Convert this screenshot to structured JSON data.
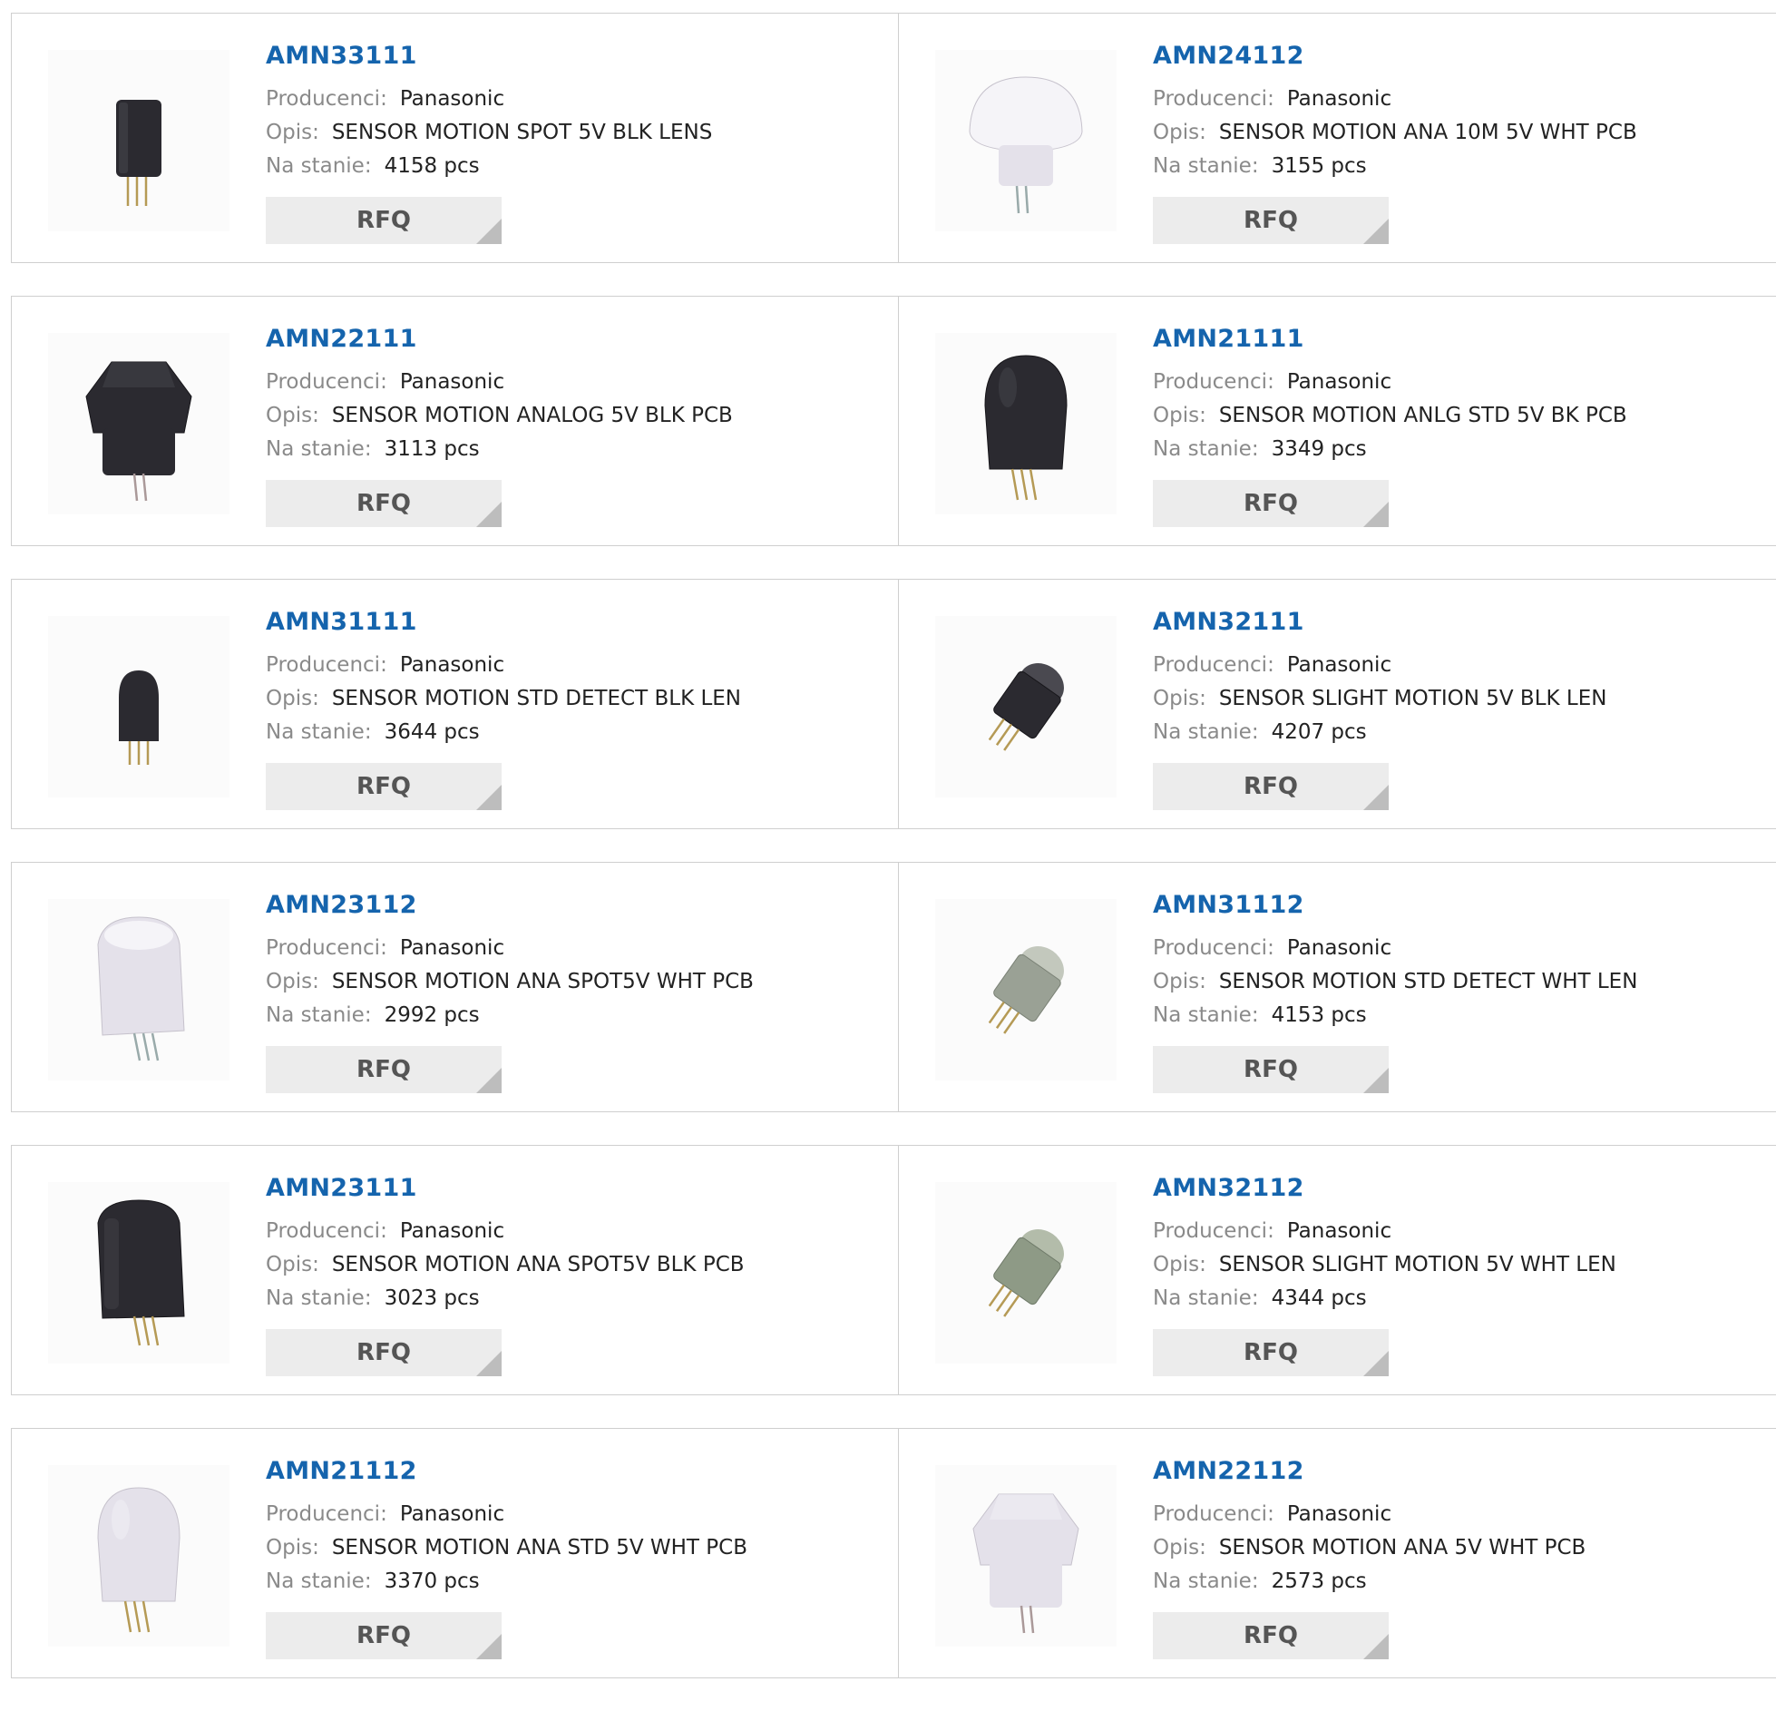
{
  "labels": {
    "manufacturer": "Producenci:",
    "description": "Opis:",
    "stock": "Na stanie:",
    "rfq": "RFQ"
  },
  "products": [
    {
      "name": "AMN33111",
      "manufacturer": "Panasonic",
      "description": "SENSOR MOTION SPOT 5V BLK LENS",
      "stock": "4158 pcs",
      "image": "sensor-spot-black"
    },
    {
      "name": "AMN24112",
      "manufacturer": "Panasonic",
      "description": "SENSOR MOTION ANA 10M 5V WHT PCB",
      "stock": "3155 pcs",
      "image": "sensor-dome-white"
    },
    {
      "name": "AMN22111",
      "manufacturer": "Panasonic",
      "description": "SENSOR MOTION ANALOG 5V BLK PCB",
      "stock": "3113 pcs",
      "image": "sensor-faceted-black"
    },
    {
      "name": "AMN21111",
      "manufacturer": "Panasonic",
      "description": "SENSOR MOTION ANLG STD 5V BK PCB",
      "stock": "3349 pcs",
      "image": "sensor-std-black"
    },
    {
      "name": "AMN31111",
      "manufacturer": "Panasonic",
      "description": "SENSOR MOTION STD DETECT BLK LEN",
      "stock": "3644 pcs",
      "image": "sensor-small-black"
    },
    {
      "name": "AMN32111",
      "manufacturer": "Panasonic",
      "description": "SENSOR SLIGHT MOTION 5V BLK LEN",
      "stock": "4207 pcs",
      "image": "sensor-tilted-black"
    },
    {
      "name": "AMN23112",
      "manufacturer": "Panasonic",
      "description": "SENSOR MOTION ANA SPOT5V WHT PCB",
      "stock": "2992 pcs",
      "image": "sensor-spot-white"
    },
    {
      "name": "AMN31112",
      "manufacturer": "Panasonic",
      "description": "SENSOR MOTION STD DETECT WHT LEN",
      "stock": "4153 pcs",
      "image": "sensor-tilted-white"
    },
    {
      "name": "AMN23111",
      "manufacturer": "Panasonic",
      "description": "SENSOR MOTION ANA SPOT5V BLK PCB",
      "stock": "3023 pcs",
      "image": "sensor-spot-black-large"
    },
    {
      "name": "AMN32112",
      "manufacturer": "Panasonic",
      "description": "SENSOR SLIGHT MOTION 5V WHT LEN",
      "stock": "4344 pcs",
      "image": "sensor-tilted-green"
    },
    {
      "name": "AMN21112",
      "manufacturer": "Panasonic",
      "description": "SENSOR MOTION ANA STD 5V WHT PCB",
      "stock": "3370 pcs",
      "image": "sensor-std-white"
    },
    {
      "name": "AMN22112",
      "manufacturer": "Panasonic",
      "description": "SENSOR MOTION ANA 5V WHT PCB",
      "stock": "2573 pcs",
      "image": "sensor-faceted-white"
    }
  ],
  "colors": {
    "link": "#1564ad",
    "label": "#8a8a8a",
    "text": "#222222",
    "rfq_bg": "#ececec",
    "border": "#cfcfcf"
  }
}
